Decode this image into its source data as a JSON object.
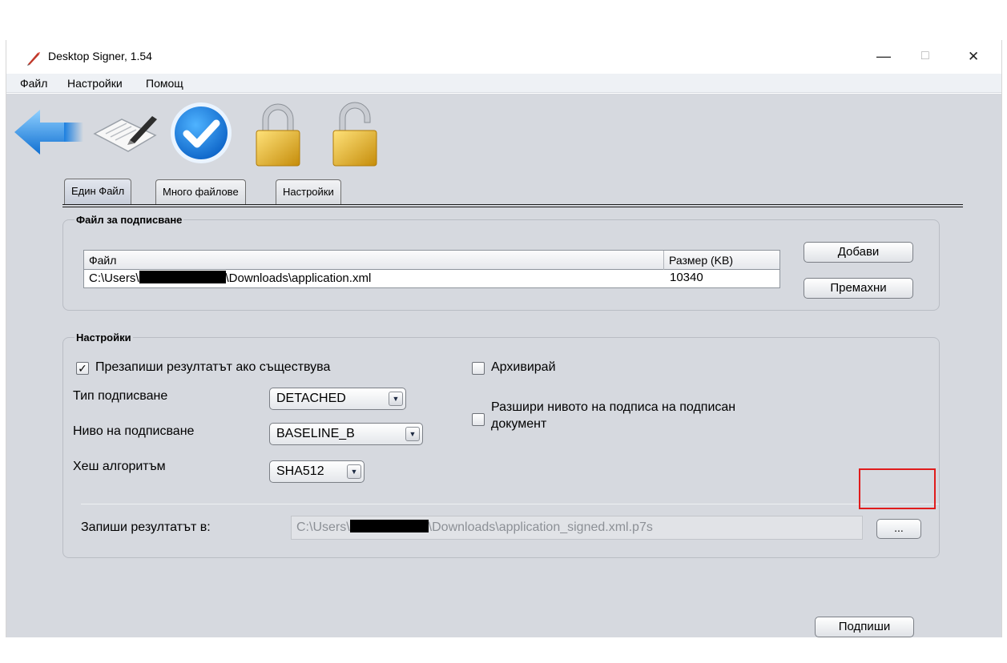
{
  "window": {
    "title": "Desktop Signer, 1.54",
    "minimize_glyph": "—",
    "maximize_glyph": "□",
    "close_glyph": "✕"
  },
  "menu": {
    "items": [
      {
        "label": "Файл"
      },
      {
        "label": "Настройки"
      },
      {
        "label": "Помощ"
      }
    ]
  },
  "toolbar": {
    "icons": [
      "back-arrow-icon",
      "sign-document-icon",
      "verify-check-icon",
      "lock-icon",
      "unlock-icon"
    ]
  },
  "tabs": [
    {
      "label": "Един Файл",
      "active": true
    },
    {
      "label": "Много файлове",
      "active": false
    },
    {
      "label": "Настройки",
      "active": false
    }
  ],
  "file_group": {
    "title": "Файл за подписване",
    "columns": [
      "Файл",
      "Размер (KB)"
    ],
    "rows": [
      {
        "path_prefix": "C:\\Users\\",
        "path_suffix": "\\Downloads\\application.xml",
        "size": "10340"
      }
    ],
    "add_label": "Добави",
    "remove_label": "Премахни"
  },
  "settings_group": {
    "title": "Настройки",
    "overwrite": {
      "label": "Презапиши резултатът ако съществува",
      "checked": true,
      "mark": "✓"
    },
    "archive": {
      "label": "Архивирай",
      "checked": false
    },
    "extend": {
      "label_line1": "Разшири нивото на подписа на подписан",
      "label_line2": "документ",
      "checked": false
    },
    "signing_type": {
      "label": "Тип подписване",
      "value": "DETACHED"
    },
    "signing_level": {
      "label": "Ниво на подписване",
      "value": "BASELINE_B"
    },
    "hash_algorithm": {
      "label": "Хеш алгоритъм",
      "value": "SHA512"
    },
    "combo_arrow_glyph": "▼",
    "output": {
      "label": "Запиши резултатът в:",
      "path_prefix": "C:\\Users\\",
      "path_suffix": "\\Downloads\\application_signed.xml.p7s",
      "browse_label": "..."
    }
  },
  "sign_label": "Подпиши",
  "colors": {
    "panel_bg": "#d6d9df",
    "highlight_border": "#e01c1c",
    "accent_blue": "#1e8de0",
    "lock_gold": "#e8b520"
  }
}
